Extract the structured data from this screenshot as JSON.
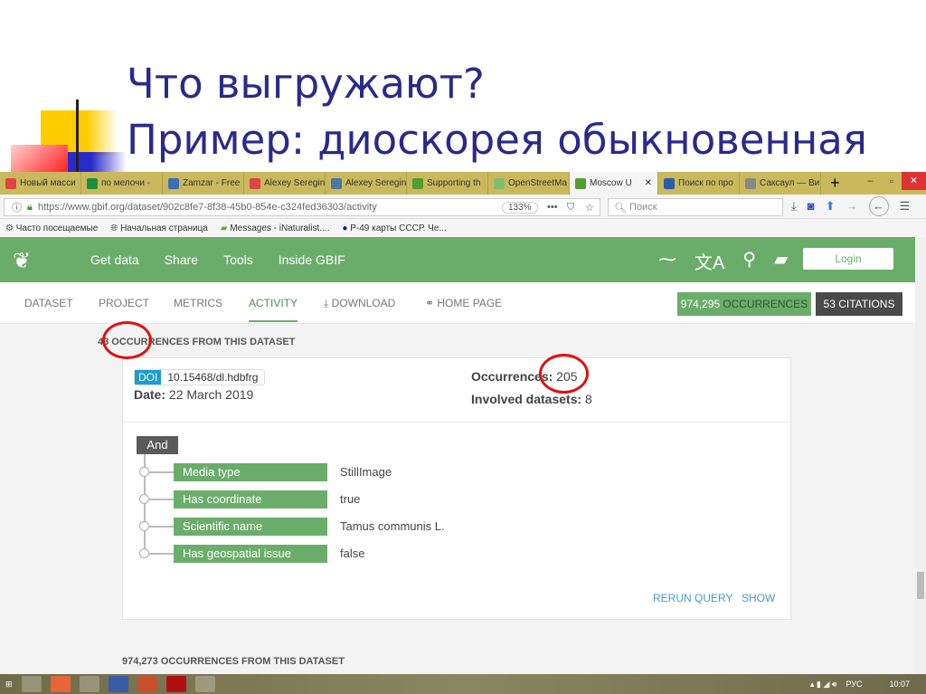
{
  "slide": {
    "title_line1": "Что выгружают?",
    "title_line2": "Пример: диоскорея обыкновенная"
  },
  "browser": {
    "tabs": [
      {
        "label": "Новый масси",
        "icon": "gmail-icon",
        "color": "#d44"
      },
      {
        "label": "по мелочи - ",
        "icon": "sheets-icon",
        "color": "#1a8f3c"
      },
      {
        "label": "Zamzar - Free",
        "icon": "zamzar-icon",
        "color": "#3b6fb5"
      },
      {
        "label": "Alexey Seregin",
        "icon": "gmail-icon",
        "color": "#d44"
      },
      {
        "label": "Alexey Seregin",
        "icon": "vk-icon",
        "color": "#4a76a8"
      },
      {
        "label": "Supporting th",
        "icon": "gbif-icon",
        "color": "#509e2f"
      },
      {
        "label": "OpenStreetMa",
        "icon": "osm-icon",
        "color": "#7ebc6f"
      },
      {
        "label": "Moscow U",
        "icon": "gbif-icon",
        "color": "#509e2f",
        "active": true
      },
      {
        "label": "Поиск по про",
        "icon": "page-icon",
        "color": "#2a5ca8"
      },
      {
        "label": "Саксаул — Ви",
        "icon": "wikipedia-icon",
        "color": "#888"
      }
    ],
    "url": "https://www.gbif.org/dataset/902c8fe7-8f38-45b0-854e-c324fed36303/activity",
    "zoom": "133%",
    "search_placeholder": "Поиск",
    "bookmarks": [
      "Часто посещаемые",
      "Начальная страница",
      "Messages - iNaturalist....",
      "P-49 карты СССР. Че..."
    ]
  },
  "gbif": {
    "nav": [
      "Get data",
      "Share",
      "Tools",
      "Inside GBIF"
    ],
    "login": "Login",
    "subnav": [
      "DATASET",
      "PROJECT",
      "METRICS",
      "ACTIVITY",
      "DOWNLOAD",
      "HOME PAGE"
    ],
    "active_subnav": "ACTIVITY",
    "occurrences_count": "974,295",
    "occurrences_label": "OCCURRENCES",
    "citations": "53 CITATIONS",
    "accent": "#6aad6a"
  },
  "download": {
    "heading": "43 OCCURRENCES FROM THIS DATASET",
    "doi_label": "DOI",
    "doi": "10.15468/dl.hdbfrg",
    "date_label": "Date:",
    "date": "22 March 2019",
    "occ_label": "Occurrences:",
    "occ": "205",
    "datasets_label": "Involved datasets:",
    "datasets": "8",
    "operator": "And",
    "filters": [
      {
        "name": "Media type",
        "value": "StillImage"
      },
      {
        "name": "Has coordinate",
        "value": "true"
      },
      {
        "name": "Scientific name",
        "value": "Tamus communis L."
      },
      {
        "name": "Has geospatial issue",
        "value": "false"
      }
    ],
    "rerun": "RERUN QUERY",
    "show": "SHOW"
  },
  "next_heading": "974,273 OCCURRENCES FROM THIS DATASET",
  "taskbar": {
    "lang": "РУС",
    "time": "10:07"
  }
}
